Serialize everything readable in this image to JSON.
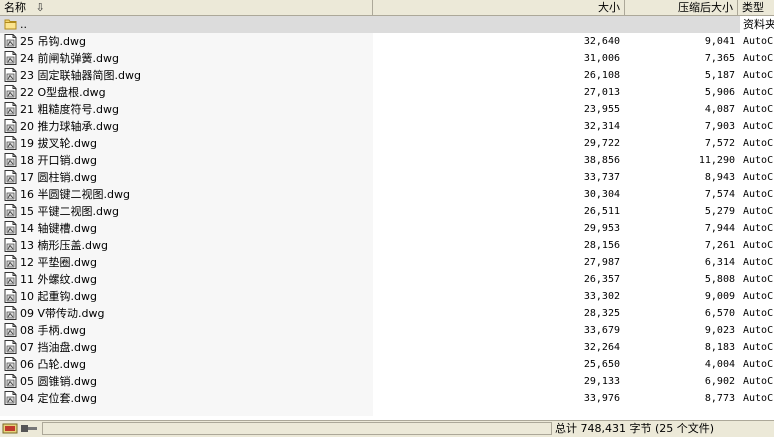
{
  "columns": {
    "name": "名称",
    "size": "大小",
    "compressed": "压缩后大小",
    "type": "类型"
  },
  "parent_row": {
    "name": "..",
    "type": "资料夹"
  },
  "files": [
    {
      "name": "25 吊钩.dwg",
      "size": "32,640",
      "compressed": "9,041",
      "type": "AutoC"
    },
    {
      "name": "24 前闸轨弹簧.dwg",
      "size": "31,006",
      "compressed": "7,365",
      "type": "AutoC"
    },
    {
      "name": "23 固定联轴器简图.dwg",
      "size": "26,108",
      "compressed": "5,187",
      "type": "AutoC"
    },
    {
      "name": "22 O型盘根.dwg",
      "size": "27,013",
      "compressed": "5,906",
      "type": "AutoC"
    },
    {
      "name": "21 粗糙度符号.dwg",
      "size": "23,955",
      "compressed": "4,087",
      "type": "AutoC"
    },
    {
      "name": "20 推力球轴承.dwg",
      "size": "32,314",
      "compressed": "7,903",
      "type": "AutoC"
    },
    {
      "name": "19 拔叉轮.dwg",
      "size": "29,722",
      "compressed": "7,572",
      "type": "AutoC"
    },
    {
      "name": "18 开口销.dwg",
      "size": "38,856",
      "compressed": "11,290",
      "type": "AutoC"
    },
    {
      "name": "17 圆柱销.dwg",
      "size": "33,737",
      "compressed": "8,943",
      "type": "AutoC"
    },
    {
      "name": "16 半圆键二视图.dwg",
      "size": "30,304",
      "compressed": "7,574",
      "type": "AutoC"
    },
    {
      "name": "15 平键二视图.dwg",
      "size": "26,511",
      "compressed": "5,279",
      "type": "AutoC"
    },
    {
      "name": "14 轴键槽.dwg",
      "size": "29,953",
      "compressed": "7,944",
      "type": "AutoC"
    },
    {
      "name": "13 楠形压盖.dwg",
      "size": "28,156",
      "compressed": "7,261",
      "type": "AutoC"
    },
    {
      "name": "12 平垫圈.dwg",
      "size": "27,987",
      "compressed": "6,314",
      "type": "AutoC"
    },
    {
      "name": "11 外螺纹.dwg",
      "size": "26,357",
      "compressed": "5,808",
      "type": "AutoC"
    },
    {
      "name": "10 起重钩.dwg",
      "size": "33,302",
      "compressed": "9,009",
      "type": "AutoC"
    },
    {
      "name": "09 V带传动.dwg",
      "size": "28,325",
      "compressed": "6,570",
      "type": "AutoC"
    },
    {
      "name": "08 手柄.dwg",
      "size": "33,679",
      "compressed": "9,023",
      "type": "AutoC"
    },
    {
      "name": "07 挡油盘.dwg",
      "size": "32,264",
      "compressed": "8,183",
      "type": "AutoC"
    },
    {
      "name": "06 凸轮.dwg",
      "size": "25,650",
      "compressed": "4,004",
      "type": "AutoC"
    },
    {
      "name": "05 圆锥销.dwg",
      "size": "29,133",
      "compressed": "6,902",
      "type": "AutoC"
    },
    {
      "name": "04 定位套.dwg",
      "size": "33,976",
      "compressed": "8,773",
      "type": "AutoC"
    }
  ],
  "status": {
    "total": "总计 748,431 字节 (25 个文件)"
  },
  "icons": {
    "parent": "folder-icon",
    "file": "dwg-file-icon",
    "sort": "sort-down-arrow-icon"
  }
}
